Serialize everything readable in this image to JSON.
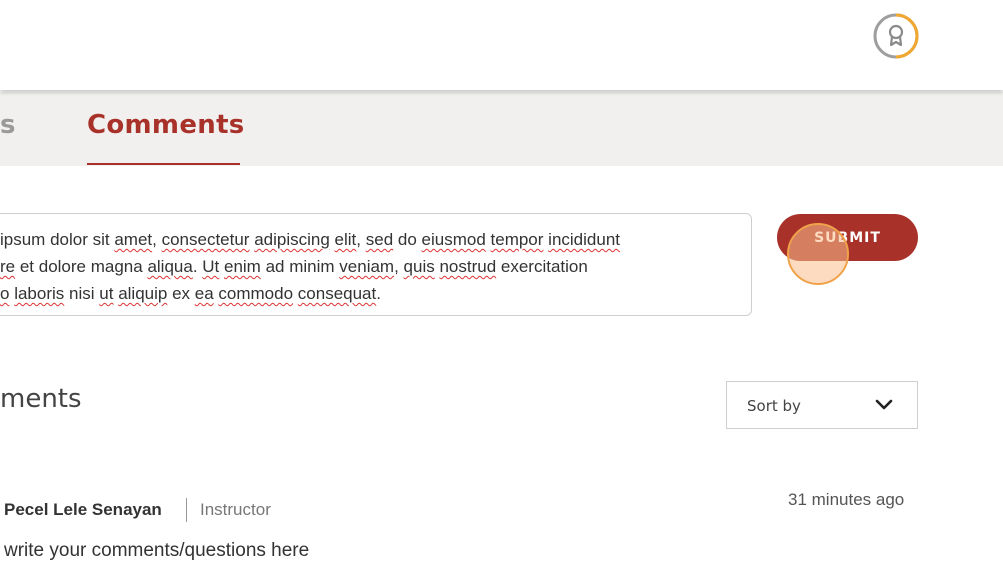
{
  "header": {
    "badge_icon": "award-ribbon-icon",
    "badge_colors": {
      "ring_gray": "#9e9e9e",
      "ring_orange": "#f0a830"
    }
  },
  "tabs": {
    "previous_partial": "s",
    "active": "Comments"
  },
  "composer": {
    "lines": [
      [
        {
          "t": "ipsum dolor sit ",
          "sq": false
        },
        {
          "t": "amet",
          "sq": true
        },
        {
          "t": ", ",
          "sq": false
        },
        {
          "t": "consectetur",
          "sq": true
        },
        {
          "t": " ",
          "sq": false
        },
        {
          "t": "adipiscing",
          "sq": true
        },
        {
          "t": " ",
          "sq": false
        },
        {
          "t": "elit",
          "sq": true
        },
        {
          "t": ", ",
          "sq": false
        },
        {
          "t": "sed",
          "sq": true
        },
        {
          "t": " do ",
          "sq": false
        },
        {
          "t": "eiusmod",
          "sq": true
        },
        {
          "t": " ",
          "sq": false
        },
        {
          "t": "tempor",
          "sq": true
        },
        {
          "t": " ",
          "sq": false
        },
        {
          "t": "incididunt",
          "sq": true
        }
      ],
      [
        {
          "t": "re",
          "sq": true
        },
        {
          "t": " et dolore magna ",
          "sq": false
        },
        {
          "t": "aliqua",
          "sq": true
        },
        {
          "t": ". ",
          "sq": false
        },
        {
          "t": "Ut",
          "sq": true
        },
        {
          "t": " ",
          "sq": false
        },
        {
          "t": "enim",
          "sq": true
        },
        {
          "t": " ad minim ",
          "sq": false
        },
        {
          "t": "veniam",
          "sq": true
        },
        {
          "t": ", ",
          "sq": false
        },
        {
          "t": "quis",
          "sq": true
        },
        {
          "t": " ",
          "sq": false
        },
        {
          "t": "nostrud",
          "sq": true
        },
        {
          "t": " exercitation",
          "sq": false
        }
      ],
      [
        {
          "t": "o",
          "sq": true
        },
        {
          "t": " ",
          "sq": false
        },
        {
          "t": "laboris",
          "sq": true
        },
        {
          "t": " nisi ",
          "sq": false
        },
        {
          "t": "ut",
          "sq": true
        },
        {
          "t": " ",
          "sq": false
        },
        {
          "t": "aliquip",
          "sq": true
        },
        {
          "t": " ex ",
          "sq": false
        },
        {
          "t": "ea",
          "sq": true
        },
        {
          "t": " ",
          "sq": false
        },
        {
          "t": "commodo",
          "sq": true
        },
        {
          "t": " ",
          "sq": false
        },
        {
          "t": "consequat",
          "sq": true
        },
        {
          "t": ".",
          "sq": false
        }
      ]
    ],
    "submit_label": "SUBMIT"
  },
  "comments": {
    "heading_partial": "ments",
    "sort": {
      "label": "Sort by",
      "icon": "chevron-down-icon"
    },
    "items": [
      {
        "author": "Pecel Lele Senayan",
        "role": "Instructor",
        "time": "31 minutes ago",
        "body": "write your comments/questions here"
      }
    ]
  },
  "colors": {
    "accent": "#a8322a",
    "tab_bar_bg": "#f1f0ee",
    "cursor_highlight": "#f0a24a"
  }
}
